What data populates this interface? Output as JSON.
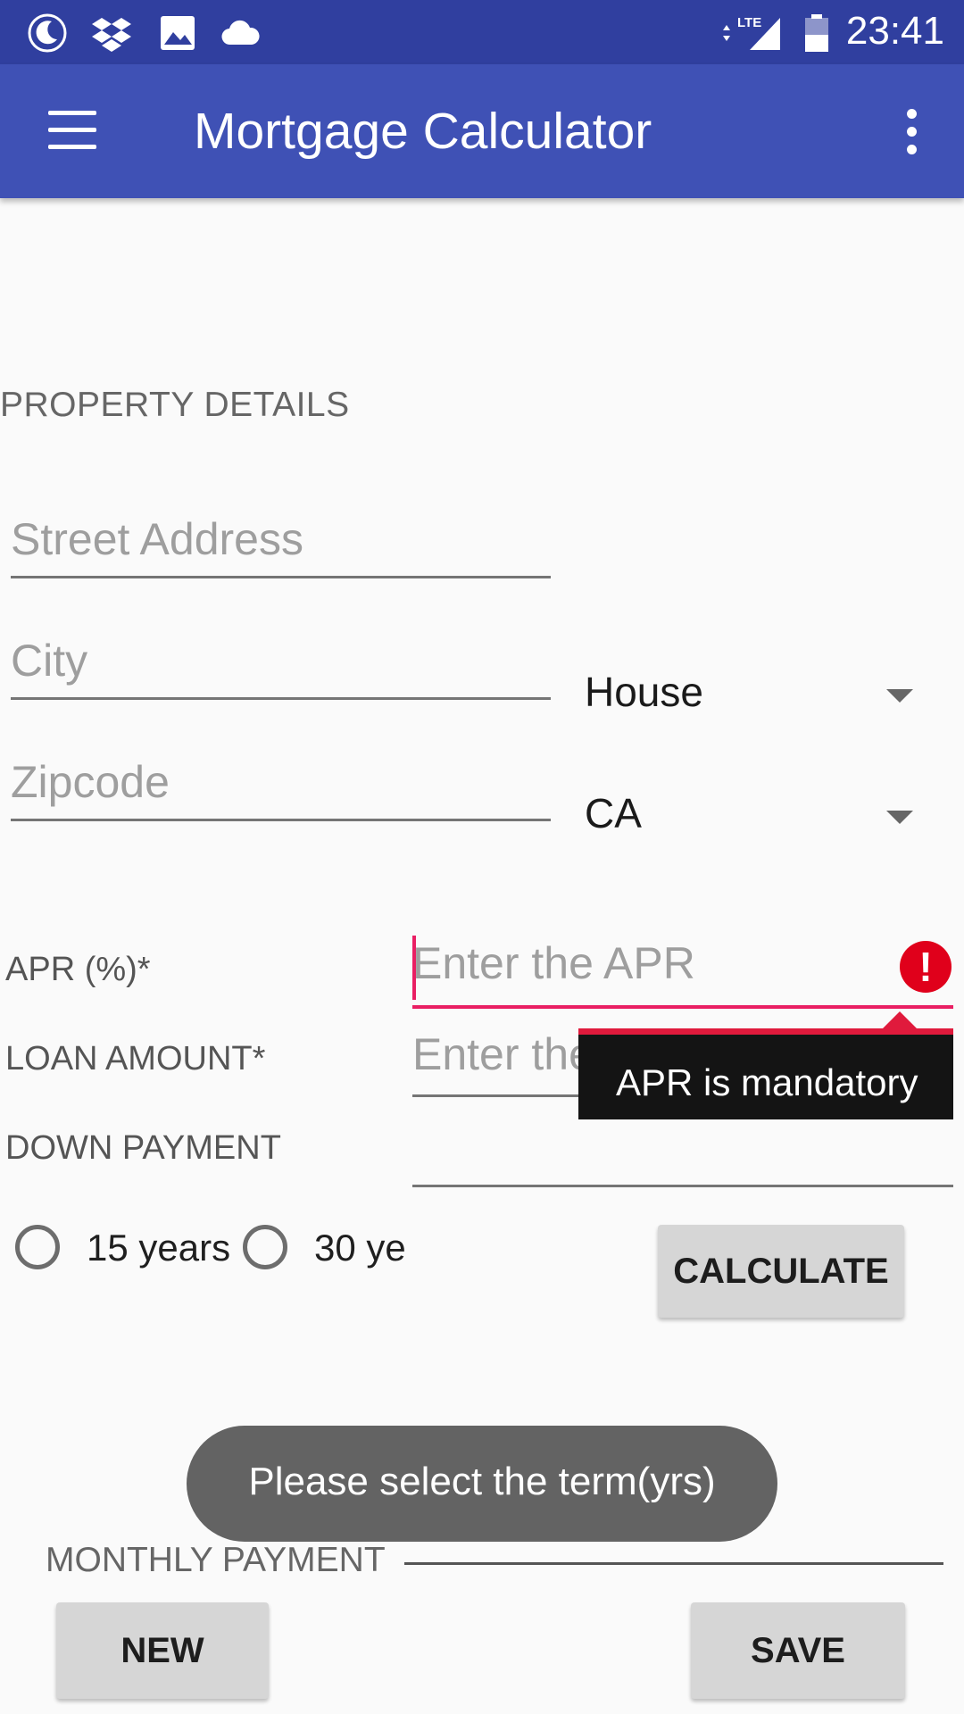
{
  "status_bar": {
    "time": "23:41",
    "icons": [
      "moon-icon",
      "dropbox-icon",
      "image-icon",
      "cloud-icon",
      "lte-signal-icon",
      "battery-icon"
    ],
    "network": "LTE"
  },
  "app_bar": {
    "title": "Mortgage Calculator",
    "color": "#3f51b5",
    "status_color": "#303f9f"
  },
  "property": {
    "section_title": "PROPERTY DETAILS",
    "street_placeholder": "Street Address",
    "city_placeholder": "City",
    "zipcode_placeholder": "Zipcode",
    "type_value": "House",
    "state_value": "CA"
  },
  "loan": {
    "apr_label": "APR (%)*",
    "apr_placeholder": "Enter the APR",
    "loan_amount_label": "LOAN AMOUNT*",
    "loan_amount_placeholder": "Enter the Loan Amount",
    "down_payment_label": "DOWN PAYMENT",
    "apr_error": "APR is mandatory",
    "error_color": "#e0001b"
  },
  "term": {
    "option_15": "15 years",
    "option_30": "30 ye"
  },
  "buttons": {
    "calculate": "CALCULATE",
    "new": "NEW",
    "save": "SAVE"
  },
  "result": {
    "monthly_payment_label": "MONTHLY PAYMENT"
  },
  "toast": {
    "message": "Please select the term(yrs)"
  }
}
